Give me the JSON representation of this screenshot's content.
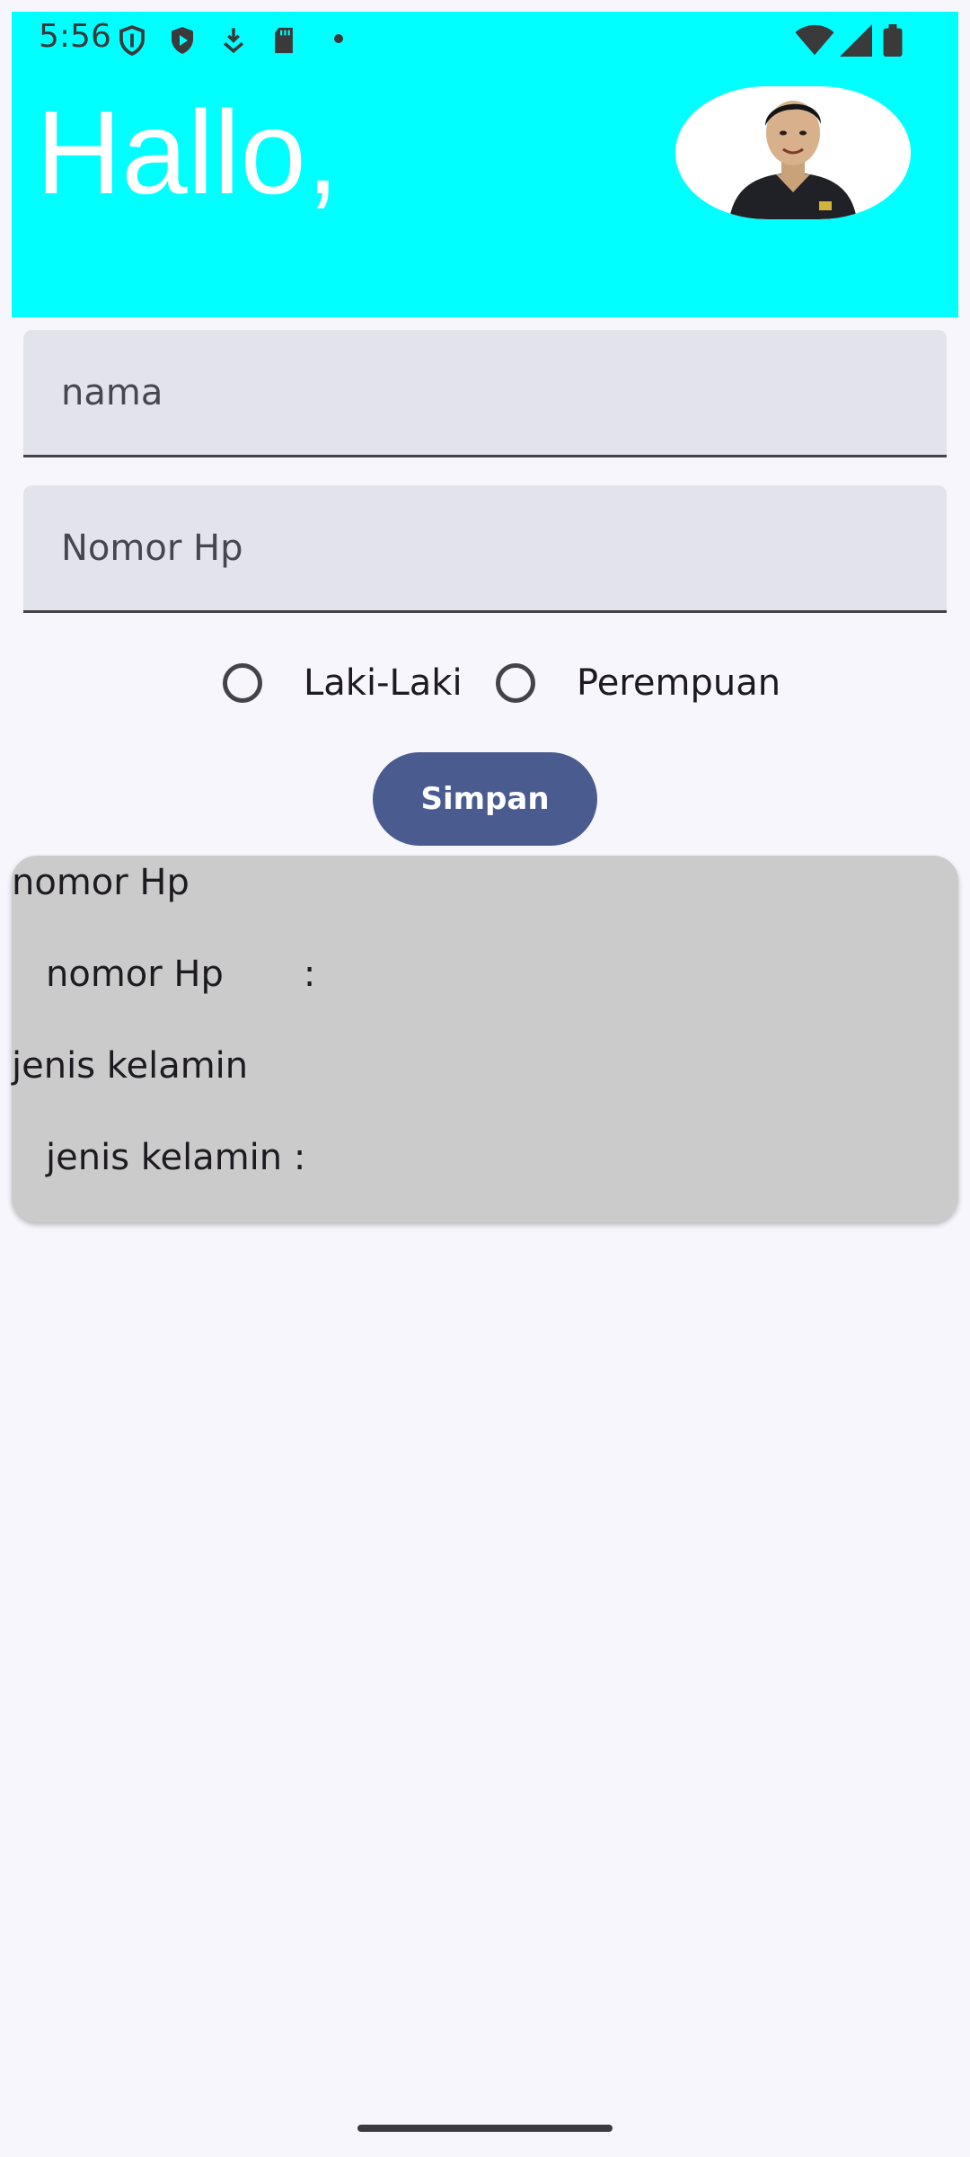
{
  "status_bar": {
    "time": "5:56",
    "left_icons": [
      "shield-outline-icon",
      "play-shield-icon",
      "download-icon",
      "sd-card-icon",
      "dot-icon"
    ],
    "right_icons": [
      "wifi-icon",
      "cell-signal-icon",
      "battery-icon"
    ]
  },
  "header": {
    "greeting": "Hallo,",
    "background_color": "#00FFFF"
  },
  "form": {
    "name_placeholder": "nama",
    "phone_placeholder": "Nomor Hp",
    "gender_options": [
      "Laki-Laki",
      "Perempuan"
    ],
    "save_label": "Simpan",
    "accent_color": "#4A5B8F"
  },
  "result_card": {
    "phone_title": "nomor Hp",
    "phone_row": "nomor Hp       :",
    "gender_title": "jenis kelamin",
    "gender_row": "jenis kelamin :",
    "background_color": "#CBCBCB"
  }
}
